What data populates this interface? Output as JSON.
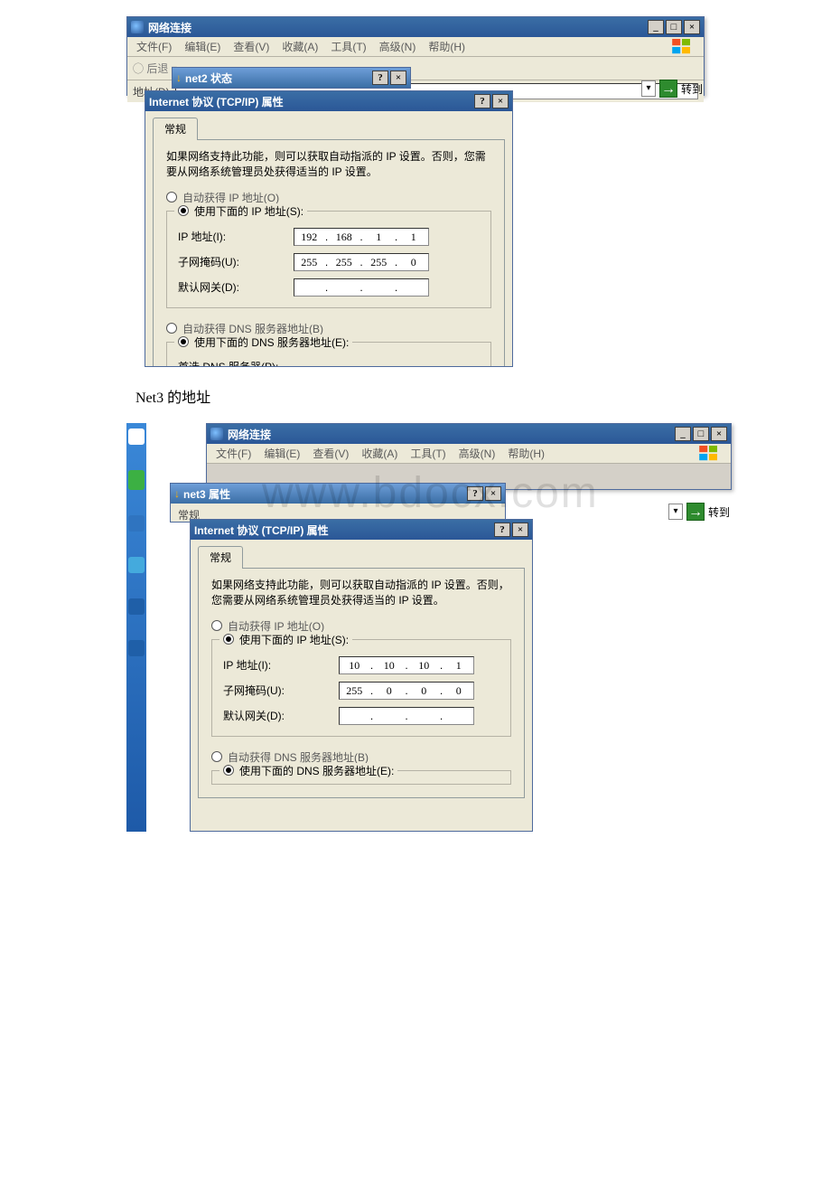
{
  "caption_net3": "Net3 的地址",
  "explorer": {
    "title": "网络连接",
    "menus": [
      "文件(F)",
      "编辑(E)",
      "查看(V)",
      "收藏(A)",
      "工具(T)",
      "高级(N)",
      "帮助(H)"
    ],
    "back": "后退",
    "addr_label": "地址(D)",
    "go": "转到"
  },
  "status2": {
    "title": "net2 状态"
  },
  "prop3": {
    "title": "net3 属性"
  },
  "tcpip": {
    "title": "Internet 协议 (TCP/IP) 属性",
    "tab": "常规",
    "desc": "如果网络支持此功能，则可以获取自动指派的 IP 设置。否则，您需要从网络系统管理员处获得适当的 IP 设置。",
    "r_obtain_ip": "自动获得 IP 地址(O)",
    "r_use_ip": "使用下面的 IP 地址(S):",
    "l_ip": "IP 地址(I):",
    "l_mask": "子网掩码(U):",
    "l_gw": "默认网关(D):",
    "r_obtain_dns": "自动获得 DNS 服务器地址(B)",
    "r_use_dns": "使用下面的 DNS 服务器地址(E):",
    "l_pref_dns": "首选 DNS 服务器(P):"
  },
  "ip_net2": {
    "ip": [
      "192",
      "168",
      "1",
      "1"
    ],
    "mask": [
      "255",
      "255",
      "255",
      "0"
    ],
    "gw": [
      "",
      "",
      "",
      ""
    ]
  },
  "ip_net3": {
    "ip": [
      "10",
      "10",
      "10",
      "1"
    ],
    "mask": [
      "255",
      "0",
      "0",
      "0"
    ],
    "gw": [
      "",
      "",
      "",
      ""
    ]
  },
  "watermark": "www.bdocx.com"
}
